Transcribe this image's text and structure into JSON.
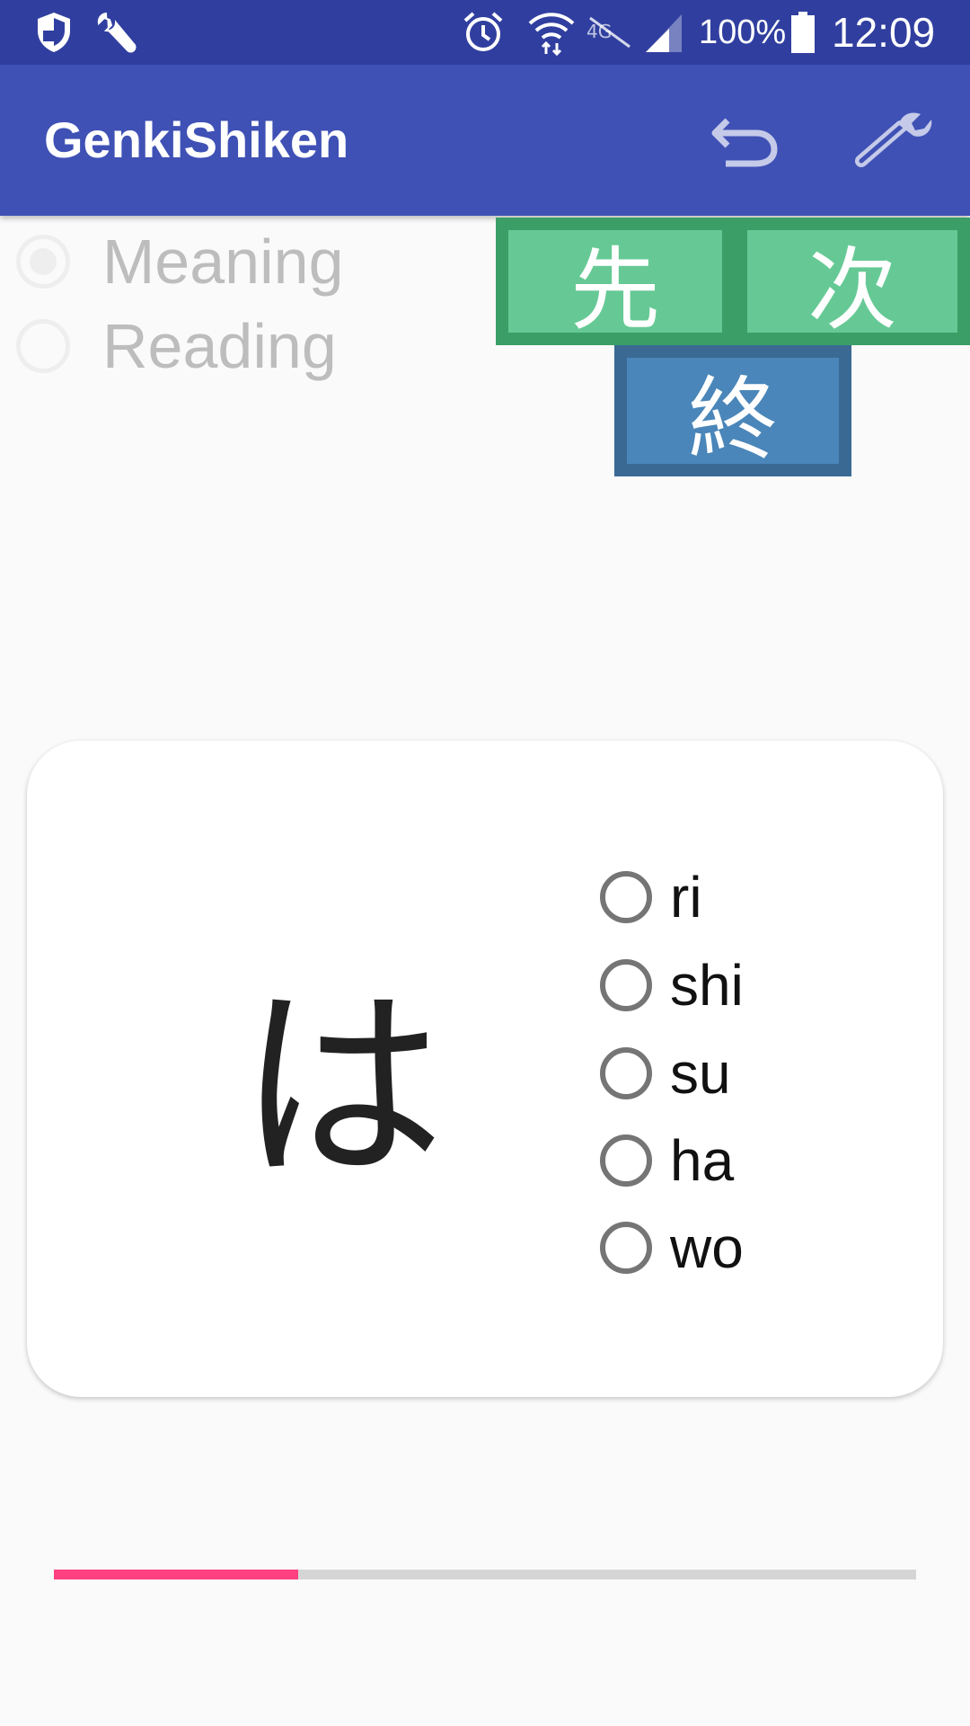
{
  "status_bar": {
    "battery_percent": "100%",
    "time": "12:09",
    "icons": [
      "shield-icon",
      "wrench-icon",
      "alarm-icon",
      "wifi-icon",
      "data-off-icon",
      "signal-icon",
      "battery-icon"
    ]
  },
  "app_bar": {
    "title": "GenkiShiken",
    "actions": [
      "undo-icon",
      "settings-wrench-icon"
    ]
  },
  "mode": {
    "options": [
      {
        "label": "Meaning",
        "selected": true
      },
      {
        "label": "Reading",
        "selected": false
      }
    ]
  },
  "nav_buttons": {
    "previous": "先",
    "next": "次",
    "end": "終"
  },
  "card": {
    "character": "は",
    "options": [
      "ri",
      "shi",
      "su",
      "ha",
      "wo"
    ]
  },
  "progress": {
    "fraction": 0.283,
    "color": "#ff4081"
  },
  "colors": {
    "status_bar": "#303f9f",
    "app_bar": "#3f51b5",
    "green_button": "#66c995",
    "blue_button": "#4a86b9"
  }
}
